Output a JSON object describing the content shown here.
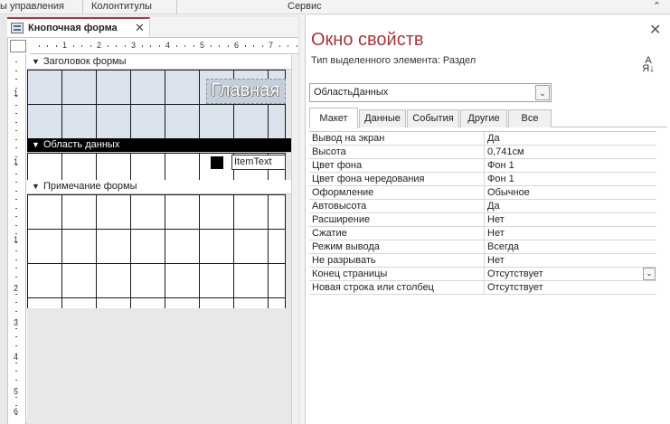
{
  "ribbon": {
    "groups": [
      "ы управления",
      "Колонтитулы",
      "Сервис"
    ],
    "collapse_icon": "chevron-up-icon"
  },
  "document": {
    "tab_label": "Кнопочная форма",
    "close_glyph": "✕",
    "ruler_top_numbers": [
      "1",
      "2",
      "3",
      "4",
      "5",
      "6",
      "7"
    ],
    "ruler_left_numbers": [
      "1",
      "1",
      "1",
      "2",
      "3",
      "4",
      "5",
      "6"
    ],
    "sections": {
      "header": "Заголовок формы",
      "detail": "Область данных",
      "footer": "Примечание формы"
    },
    "title_label_text": "Главная",
    "item_text_field": "ItemText"
  },
  "properties": {
    "title": "Окно свойств",
    "selection_type": "Тип выделенного элемента:  Раздел",
    "selected_object": "ОбластьДанных",
    "sort_icon_text": "А\nЯ",
    "tabs": [
      {
        "label": "Макет",
        "active": true
      },
      {
        "label": "Данные",
        "active": false
      },
      {
        "label": "События",
        "active": false
      },
      {
        "label": "Другие",
        "active": false
      },
      {
        "label": "Все",
        "active": false
      }
    ],
    "rows": [
      {
        "name": "Вывод на экран",
        "value": "Да"
      },
      {
        "name": "Высота",
        "value": "0,741см"
      },
      {
        "name": "Цвет фона",
        "value": "Фон 1"
      },
      {
        "name": "Цвет фона чередования",
        "value": "Фон 1"
      },
      {
        "name": "Оформление",
        "value": "Обычное"
      },
      {
        "name": "Автовысота",
        "value": "Да"
      },
      {
        "name": "Расширение",
        "value": "Нет"
      },
      {
        "name": "Сжатие",
        "value": "Нет"
      },
      {
        "name": "Режим вывода",
        "value": "Всегда"
      },
      {
        "name": "Не разрывать",
        "value": "Нет"
      },
      {
        "name": "Конец страницы",
        "value": "Отсутствует"
      },
      {
        "name": "Новая строка или столбец",
        "value": "Отсутствует"
      }
    ]
  },
  "colors": {
    "accent": "#a4373a",
    "section_dark": "#000000",
    "header_fill": "#dde3ec"
  }
}
